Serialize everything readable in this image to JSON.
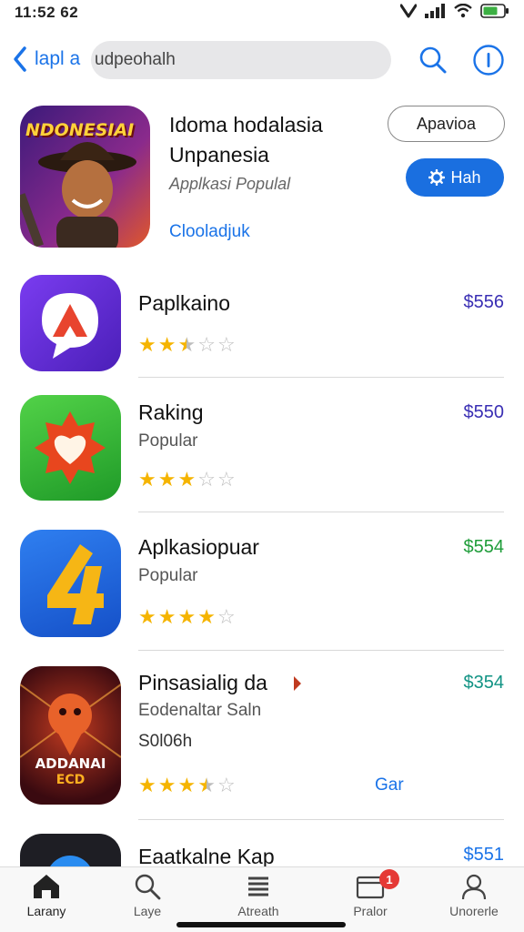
{
  "status": {
    "time": "11:52 62"
  },
  "nav": {
    "back_label": "lapl a",
    "search_value": "udpeohalh"
  },
  "featured": {
    "title_line1": "Idoma hodalasia",
    "title_line2": "Unpanesia",
    "subtitle": "Applkasi Populal",
    "link": "Clooladjuk",
    "button_outline": "Apavioa",
    "button_primary": "Hah",
    "icon_text": "NDONESIAI"
  },
  "apps": [
    {
      "title": "Paplkaino",
      "price": "$556",
      "price_color": "#3a2fb4",
      "rating": 2.5
    },
    {
      "title": "Raking",
      "subtitle": "Popular",
      "price": "$550",
      "price_color": "#3a2fb4",
      "rating": 3
    },
    {
      "title": "Aplkasiopuar",
      "subtitle": "Popular",
      "price": "$554",
      "price_color": "#1f9d3a",
      "rating": 4
    },
    {
      "title": "Pinsasialig da",
      "subtitle": "Eodenaltar Saln",
      "extra": "S0l06h",
      "price": "$354",
      "price_color": "#119384",
      "rating": 3.5,
      "action": "Gar",
      "icon_text1": "ADDANAI",
      "icon_text2": "ECD"
    },
    {
      "title": "Eaatkalne Kap",
      "price": "$551",
      "price_color": "#1a73e8"
    }
  ],
  "tabs": [
    {
      "label": "Larany",
      "icon": "home-icon"
    },
    {
      "label": "Laye",
      "icon": "search-icon"
    },
    {
      "label": "Atreath",
      "icon": "list-icon"
    },
    {
      "label": "Pralor",
      "icon": "inbox-icon",
      "badge": "1"
    },
    {
      "label": "Unorerle",
      "icon": "person-icon"
    }
  ],
  "colors": {
    "accent": "#1a73e8",
    "primary_button": "#1a6fe0",
    "star": "#f5b400"
  }
}
